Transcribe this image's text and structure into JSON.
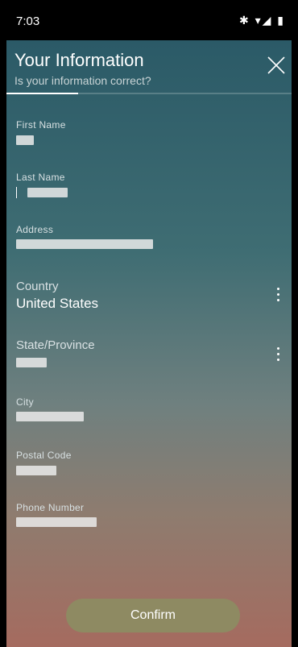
{
  "status_bar": {
    "time": "7:03",
    "icons": "✱ ▾◢ ▮"
  },
  "header": {
    "title": "Your Information",
    "subtitle": "Is your information correct?",
    "progress_fraction": 0.25
  },
  "fields": {
    "first_name": {
      "label": "First Name"
    },
    "last_name": {
      "label": "Last Name"
    },
    "address": {
      "label": "Address"
    },
    "country": {
      "label": "Country",
      "value": "United States"
    },
    "state": {
      "label": "State/Province"
    },
    "city": {
      "label": "City"
    },
    "postal_code": {
      "label": "Postal Code"
    },
    "phone": {
      "label": "Phone Number"
    }
  },
  "confirm_label": "Confirm"
}
